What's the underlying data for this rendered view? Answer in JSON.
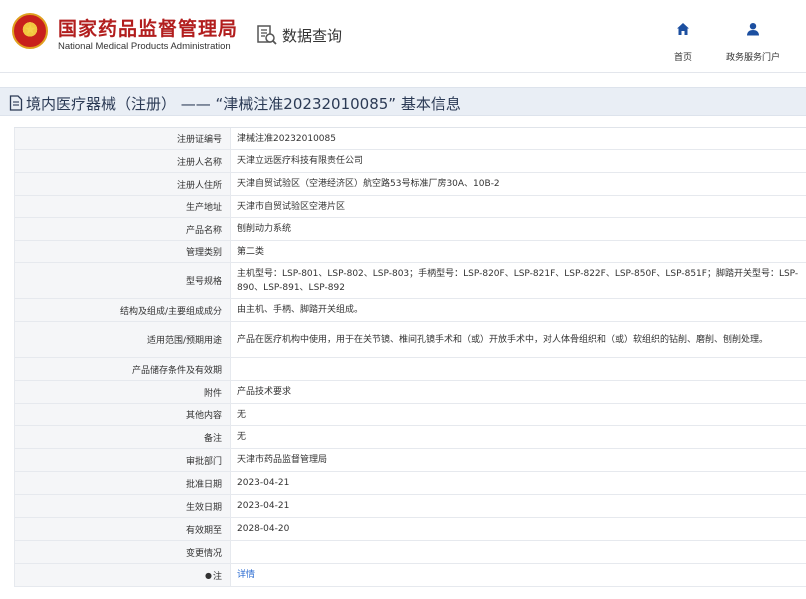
{
  "header": {
    "brand_cn": "国家药品监督管理局",
    "brand_en": "National Medical Products Administration",
    "search_label": "数据查询",
    "nav": [
      {
        "label": "首页",
        "icon": "home-icon"
      },
      {
        "label": "政务服务门户",
        "icon": "user-icon"
      }
    ]
  },
  "page": {
    "title": "境内医疗器械（注册） ——  “津械注准20232010085”  基本信息"
  },
  "table": {
    "rows": [
      {
        "label": "注册证编号",
        "value": "津械注准20232010085"
      },
      {
        "label": "注册人名称",
        "value": "天津立远医疗科技有限责任公司"
      },
      {
        "label": "注册人住所",
        "value": "天津自贸试验区（空港经济区）航空路53号标准厂房30A、10B-2"
      },
      {
        "label": "生产地址",
        "value": "天津市自贸试验区空港片区"
      },
      {
        "label": "产品名称",
        "value": "刨削动力系统"
      },
      {
        "label": "管理类别",
        "value": "第二类"
      },
      {
        "label": "型号规格",
        "value": "主机型号：LSP-801、LSP-802、LSP-803；手柄型号：LSP-820F、LSP-821F、LSP-822F、LSP-850F、LSP-851F；脚踏开关型号：LSP-890、LSP-891、LSP-892"
      },
      {
        "label": "结构及组成/主要组成成分",
        "value": "由主机、手柄、脚踏开关组成。"
      },
      {
        "label": "适用范围/预期用途",
        "value": "产品在医疗机构中使用，用于在关节镜、椎间孔镜手术和（或）开放手术中，对人体骨组织和（或）软组织的钻削、磨削、刨削处理。"
      },
      {
        "label": "产品储存条件及有效期",
        "value": ""
      },
      {
        "label": "附件",
        "value": "产品技术要求"
      },
      {
        "label": "其他内容",
        "value": "无"
      },
      {
        "label": "备注",
        "value": "无"
      },
      {
        "label": "审批部门",
        "value": "天津市药品监督管理局"
      },
      {
        "label": "批准日期",
        "value": "2023-04-21"
      },
      {
        "label": "生效日期",
        "value": "2023-04-21"
      },
      {
        "label": "有效期至",
        "value": "2028-04-20"
      },
      {
        "label": "变更情况",
        "value": ""
      },
      {
        "label": "注",
        "value": "详情",
        "link": true
      }
    ]
  },
  "colors": {
    "brand_red": "#b21e1e",
    "nav_blue": "#1c4fa0",
    "link_blue": "#2a6bd1",
    "title_bg": "#e9eef5"
  }
}
